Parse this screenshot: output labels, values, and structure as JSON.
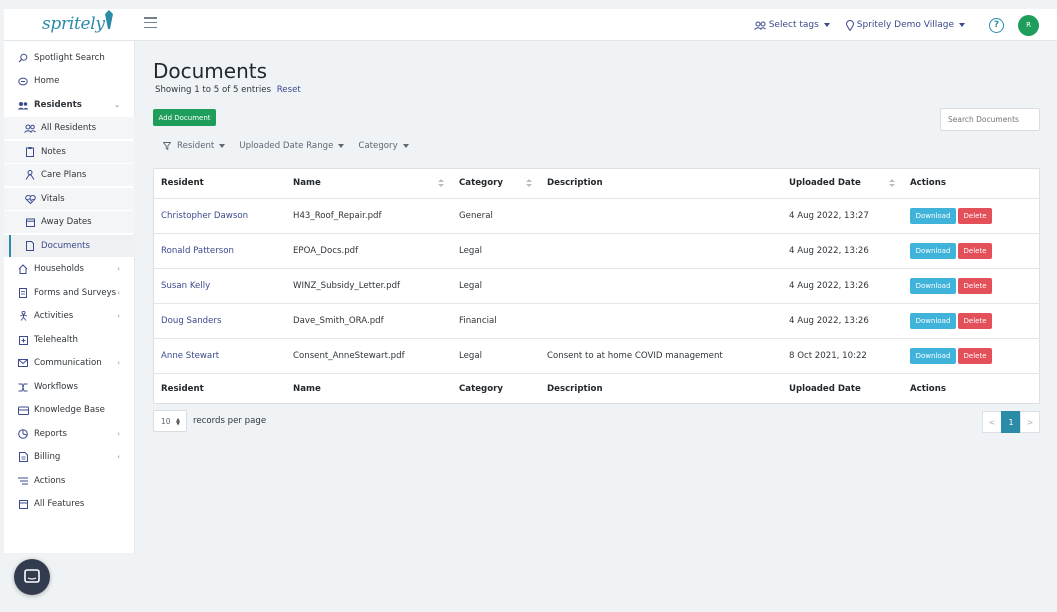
{
  "brand": {
    "logo_text": "spritely",
    "accent": "#2b8ca8",
    "green": "#1f9e5b"
  },
  "header": {
    "select_tags": "Select tags",
    "facility": "Spritely Demo Village",
    "help_symbol": "?",
    "avatar_initial": "R"
  },
  "sidebar": {
    "items": [
      {
        "label": "Spotlight Search",
        "icon": "search-icon"
      },
      {
        "label": "Home",
        "icon": "home-icon"
      },
      {
        "label": "Residents",
        "icon": "residents-icon"
      },
      {
        "label": "All Residents",
        "icon": "people-icon"
      },
      {
        "label": "Notes",
        "icon": "notes-icon"
      },
      {
        "label": "Care Plans",
        "icon": "care-plan-icon"
      },
      {
        "label": "Vitals",
        "icon": "vitals-icon"
      },
      {
        "label": "Away Dates",
        "icon": "calendar-icon"
      },
      {
        "label": "Documents",
        "icon": "document-icon"
      },
      {
        "label": "Households",
        "icon": "house-icon"
      },
      {
        "label": "Forms and Surveys",
        "icon": "form-icon"
      },
      {
        "label": "Activities",
        "icon": "activity-icon"
      },
      {
        "label": "Telehealth",
        "icon": "telehealth-icon"
      },
      {
        "label": "Communication",
        "icon": "mail-icon"
      },
      {
        "label": "Workflows",
        "icon": "workflow-icon"
      },
      {
        "label": "Knowledge Base",
        "icon": "knowledge-icon"
      },
      {
        "label": "Reports",
        "icon": "reports-icon"
      },
      {
        "label": "Billing",
        "icon": "billing-icon"
      },
      {
        "label": "Actions",
        "icon": "list-icon"
      },
      {
        "label": "All Features",
        "icon": "features-icon"
      }
    ]
  },
  "main": {
    "title": "Documents",
    "showing": "Showing 1 to 5 of 5 entries",
    "reset": "Reset",
    "add_button": "Add Document",
    "search_placeholder": "Search Documents",
    "filters": [
      "Resident",
      "Uploaded Date Range",
      "Category"
    ]
  },
  "table": {
    "columns": [
      "Resident",
      "Name",
      "Category",
      "Description",
      "Uploaded Date",
      "Actions"
    ],
    "rows": [
      {
        "resident": "Christopher Dawson",
        "name": "H43_Roof_Repair.pdf",
        "category": "General",
        "description": "",
        "uploaded": "4 Aug 2022, 13:27"
      },
      {
        "resident": "Ronald Patterson",
        "name": "EPOA_Docs.pdf",
        "category": "Legal",
        "description": "",
        "uploaded": "4 Aug 2022, 13:26"
      },
      {
        "resident": "Susan Kelly",
        "name": "WINZ_Subsidy_Letter.pdf",
        "category": "Legal",
        "description": "",
        "uploaded": "4 Aug 2022, 13:26"
      },
      {
        "resident": "Doug Sanders",
        "name": "Dave_Smith_ORA.pdf",
        "category": "Financial",
        "description": "",
        "uploaded": "4 Aug 2022, 13:26"
      },
      {
        "resident": "Anne Stewart",
        "name": "Consent_AnneStewart.pdf",
        "category": "Legal",
        "description": "Consent to at home COVID management",
        "uploaded": "8 Oct 2021, 10:22"
      }
    ],
    "download_label": "Download",
    "delete_label": "Delete"
  },
  "footer": {
    "per_page_value": "10",
    "per_page_label": "records per page",
    "pager": {
      "prev": "<",
      "current": "1",
      "next": ">"
    }
  }
}
